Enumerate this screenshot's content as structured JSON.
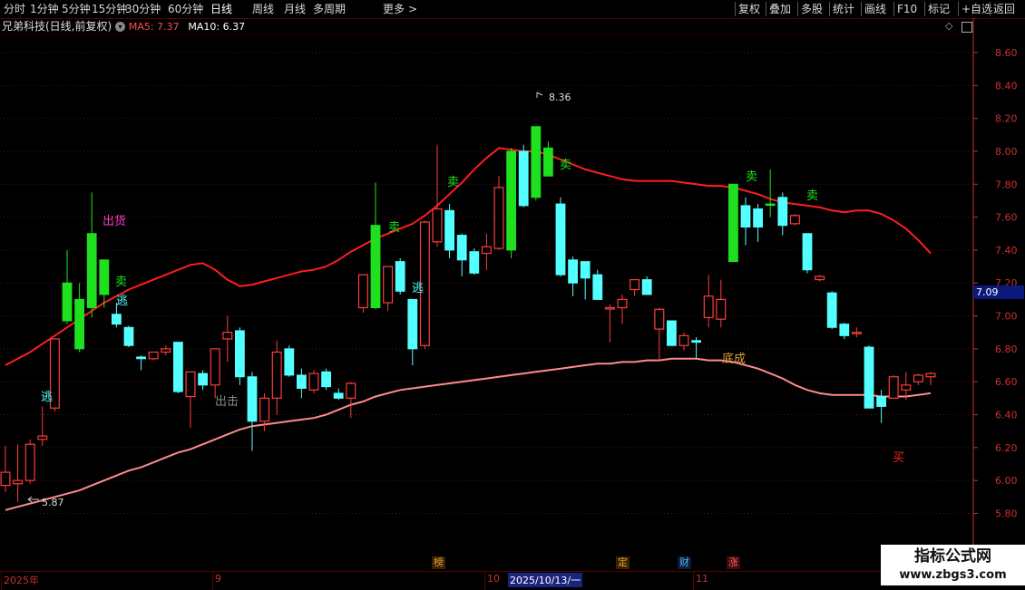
{
  "toolbar": {
    "periods": [
      "分时",
      "1分钟",
      "5分钟",
      "15分钟",
      "30分钟",
      "60分钟",
      "日线",
      "周线",
      "月线",
      "多周期"
    ],
    "active_period": "日线",
    "more_label": "更多",
    "right_buttons": [
      "复权",
      "叠加",
      "多股",
      "统计",
      "画线",
      "F10",
      "标记",
      "+自选",
      "返回"
    ]
  },
  "title": {
    "stock": "兄弟科技(日线,前复权)",
    "ma5": "MA5: 7.37",
    "ma10": "MA10: 6.37"
  },
  "colors": {
    "up": "#ff3c3c",
    "down": "#54ffff",
    "signal_green": "#1ee01e",
    "ma_red": "#ff1e1e",
    "ma_pink": "#ff8a8a",
    "ma5_text": "#ff4b4b",
    "ma10_text": "#ffffff",
    "axis": "#c83030"
  },
  "axis": {
    "ticks": [
      "8.60",
      "8.40",
      "8.20",
      "8.00",
      "7.80",
      "7.60",
      "7.40",
      "7.20",
      "7.00",
      "6.80",
      "6.60",
      "6.40",
      "6.20",
      "6.00",
      "5.80"
    ],
    "last_price": "7.09"
  },
  "dates": {
    "labels": [
      "2025年",
      "9",
      "10",
      "2025/10/13/一",
      "11"
    ]
  },
  "events": [
    "榜",
    "定",
    "财",
    "涨"
  ],
  "annotations": {
    "high": "8.36",
    "low": "5.87",
    "sell": "卖",
    "escape": "逃",
    "ship": "出货",
    "attack": "出击",
    "bottom": "底成",
    "buy": "买"
  },
  "watermark": {
    "line1": "指标公式网",
    "line2": "www.zbgs3.com"
  },
  "chart_data": {
    "type": "candlestick",
    "ylim": [
      5.74,
      8.72
    ],
    "candles": [
      {
        "o": 5.97,
        "h": 6.21,
        "l": 5.93,
        "c": 6.05,
        "sig": ""
      },
      {
        "o": 5.98,
        "h": 6.22,
        "l": 5.87,
        "c": 6.0,
        "sig": ""
      },
      {
        "o": 6.0,
        "h": 6.25,
        "l": 5.98,
        "c": 6.22,
        "sig": ""
      },
      {
        "o": 6.25,
        "h": 6.45,
        "l": 6.21,
        "c": 6.27,
        "sig": ""
      },
      {
        "o": 6.44,
        "h": 6.86,
        "l": 6.42,
        "c": 6.86,
        "sig": ""
      },
      {
        "o": 6.97,
        "h": 7.4,
        "l": 6.95,
        "c": 7.2,
        "sig": "g"
      },
      {
        "o": 6.8,
        "h": 7.2,
        "l": 6.78,
        "c": 7.1,
        "sig": "g"
      },
      {
        "o": 7.05,
        "h": 7.75,
        "l": 6.99,
        "c": 7.5,
        "sig": "g"
      },
      {
        "o": 7.34,
        "h": 7.34,
        "l": 7.05,
        "c": 7.13,
        "sig": "g"
      },
      {
        "o": 7.01,
        "h": 7.08,
        "l": 6.93,
        "c": 6.95,
        "sig": ""
      },
      {
        "o": 6.93,
        "h": 6.94,
        "l": 6.81,
        "c": 6.82,
        "sig": ""
      },
      {
        "o": 6.75,
        "h": 6.76,
        "l": 6.67,
        "c": 6.74,
        "sig": ""
      },
      {
        "o": 6.74,
        "h": 6.78,
        "l": 6.73,
        "c": 6.78,
        "sig": ""
      },
      {
        "o": 6.78,
        "h": 6.82,
        "l": 6.76,
        "c": 6.8,
        "sig": ""
      },
      {
        "o": 6.84,
        "h": 6.84,
        "l": 6.53,
        "c": 6.54,
        "sig": ""
      },
      {
        "o": 6.51,
        "h": 6.66,
        "l": 6.32,
        "c": 6.66,
        "sig": ""
      },
      {
        "o": 6.65,
        "h": 6.67,
        "l": 6.55,
        "c": 6.58,
        "sig": ""
      },
      {
        "o": 6.58,
        "h": 6.78,
        "l": 6.5,
        "c": 6.8,
        "sig": ""
      },
      {
        "o": 6.86,
        "h": 7.0,
        "l": 6.72,
        "c": 6.9,
        "sig": ""
      },
      {
        "o": 6.91,
        "h": 6.93,
        "l": 6.58,
        "c": 6.63,
        "sig": ""
      },
      {
        "o": 6.63,
        "h": 6.66,
        "l": 6.18,
        "c": 6.36,
        "sig": ""
      },
      {
        "o": 6.36,
        "h": 6.53,
        "l": 6.3,
        "c": 6.5,
        "sig": ""
      },
      {
        "o": 6.5,
        "h": 6.85,
        "l": 6.4,
        "c": 6.78,
        "sig": ""
      },
      {
        "o": 6.8,
        "h": 6.82,
        "l": 6.63,
        "c": 6.64,
        "sig": ""
      },
      {
        "o": 6.64,
        "h": 6.68,
        "l": 6.5,
        "c": 6.56,
        "sig": ""
      },
      {
        "o": 6.55,
        "h": 6.67,
        "l": 6.53,
        "c": 6.65,
        "sig": ""
      },
      {
        "o": 6.66,
        "h": 6.68,
        "l": 6.55,
        "c": 6.57,
        "sig": ""
      },
      {
        "o": 6.53,
        "h": 6.56,
        "l": 6.49,
        "c": 6.5,
        "sig": ""
      },
      {
        "o": 6.5,
        "h": 6.6,
        "l": 6.38,
        "c": 6.59,
        "sig": ""
      },
      {
        "o": 7.05,
        "h": 7.25,
        "l": 7.02,
        "c": 7.25,
        "sig": ""
      },
      {
        "o": 7.55,
        "h": 7.81,
        "l": 7.04,
        "c": 7.05,
        "sig": "g"
      },
      {
        "o": 7.08,
        "h": 7.3,
        "l": 7.03,
        "c": 7.3,
        "sig": ""
      },
      {
        "o": 7.33,
        "h": 7.35,
        "l": 7.13,
        "c": 7.15,
        "sig": ""
      },
      {
        "o": 7.1,
        "h": 7.1,
        "l": 6.7,
        "c": 6.8,
        "sig": ""
      },
      {
        "o": 6.82,
        "h": 7.58,
        "l": 6.8,
        "c": 7.57,
        "sig": ""
      },
      {
        "o": 7.45,
        "h": 8.04,
        "l": 7.42,
        "c": 7.65,
        "sig": ""
      },
      {
        "o": 7.64,
        "h": 7.68,
        "l": 7.35,
        "c": 7.4,
        "sig": ""
      },
      {
        "o": 7.49,
        "h": 7.5,
        "l": 7.24,
        "c": 7.34,
        "sig": ""
      },
      {
        "o": 7.39,
        "h": 7.41,
        "l": 7.25,
        "c": 7.26,
        "sig": ""
      },
      {
        "o": 7.38,
        "h": 7.5,
        "l": 7.28,
        "c": 7.42,
        "sig": ""
      },
      {
        "o": 7.41,
        "h": 7.85,
        "l": 7.4,
        "c": 7.78,
        "sig": ""
      },
      {
        "o": 7.4,
        "h": 8.02,
        "l": 7.35,
        "c": 8.0,
        "sig": "g"
      },
      {
        "o": 8.0,
        "h": 8.04,
        "l": 7.66,
        "c": 7.67,
        "sig": ""
      },
      {
        "o": 7.72,
        "h": 8.15,
        "l": 7.7,
        "c": 8.15,
        "sig": "g"
      },
      {
        "o": 8.02,
        "h": 8.06,
        "l": 7.86,
        "c": 7.85,
        "sig": "g"
      },
      {
        "o": 7.68,
        "h": 7.72,
        "l": 7.24,
        "c": 7.25,
        "sig": ""
      },
      {
        "o": 7.34,
        "h": 7.36,
        "l": 7.12,
        "c": 7.2,
        "sig": ""
      },
      {
        "o": 7.33,
        "h": 7.33,
        "l": 7.1,
        "c": 7.23,
        "sig": ""
      },
      {
        "o": 7.25,
        "h": 7.28,
        "l": 7.1,
        "c": 7.1,
        "sig": ""
      },
      {
        "o": 7.05,
        "h": 7.07,
        "l": 6.84,
        "c": 7.05,
        "sig": ""
      },
      {
        "o": 7.05,
        "h": 7.13,
        "l": 6.95,
        "c": 7.1,
        "sig": ""
      },
      {
        "o": 7.16,
        "h": 7.22,
        "l": 7.12,
        "c": 7.22,
        "sig": ""
      },
      {
        "o": 7.22,
        "h": 7.24,
        "l": 7.13,
        "c": 7.13,
        "sig": ""
      },
      {
        "o": 6.92,
        "h": 7.05,
        "l": 6.73,
        "c": 7.04,
        "sig": ""
      },
      {
        "o": 6.97,
        "h": 6.97,
        "l": 6.82,
        "c": 6.82,
        "sig": ""
      },
      {
        "o": 6.82,
        "h": 6.9,
        "l": 6.79,
        "c": 6.88,
        "sig": ""
      },
      {
        "o": 6.85,
        "h": 6.87,
        "l": 6.74,
        "c": 6.84,
        "sig": ""
      },
      {
        "o": 6.99,
        "h": 7.25,
        "l": 6.93,
        "c": 7.12,
        "sig": ""
      },
      {
        "o": 6.98,
        "h": 7.22,
        "l": 6.93,
        "c": 7.1,
        "sig": ""
      },
      {
        "o": 7.33,
        "h": 7.8,
        "l": 7.33,
        "c": 7.8,
        "sig": "g"
      },
      {
        "o": 7.67,
        "h": 7.72,
        "l": 7.43,
        "c": 7.54,
        "sig": ""
      },
      {
        "o": 7.65,
        "h": 7.68,
        "l": 7.45,
        "c": 7.54,
        "sig": ""
      },
      {
        "o": 7.68,
        "h": 7.89,
        "l": 7.6,
        "c": 7.68,
        "sig": "g"
      },
      {
        "o": 7.72,
        "h": 7.75,
        "l": 7.49,
        "c": 7.55,
        "sig": ""
      },
      {
        "o": 7.56,
        "h": 7.62,
        "l": 7.55,
        "c": 7.61,
        "sig": ""
      },
      {
        "o": 7.5,
        "h": 7.5,
        "l": 7.26,
        "c": 7.28,
        "sig": ""
      },
      {
        "o": 7.22,
        "h": 7.25,
        "l": 7.21,
        "c": 7.24,
        "sig": ""
      },
      {
        "o": 7.14,
        "h": 7.15,
        "l": 6.92,
        "c": 6.93,
        "sig": ""
      },
      {
        "o": 6.95,
        "h": 6.96,
        "l": 6.86,
        "c": 6.88,
        "sig": ""
      },
      {
        "o": 6.9,
        "h": 6.93,
        "l": 6.87,
        "c": 6.9,
        "sig": ""
      },
      {
        "o": 6.81,
        "h": 6.82,
        "l": 6.44,
        "c": 6.44,
        "sig": ""
      },
      {
        "o": 6.51,
        "h": 6.55,
        "l": 6.35,
        "c": 6.45,
        "sig": ""
      },
      {
        "o": 6.5,
        "h": 6.64,
        "l": 6.5,
        "c": 6.63,
        "sig": ""
      },
      {
        "o": 6.55,
        "h": 6.66,
        "l": 6.49,
        "c": 6.58,
        "sig": ""
      },
      {
        "o": 6.6,
        "h": 6.65,
        "l": 6.58,
        "c": 6.64,
        "sig": ""
      },
      {
        "o": 6.63,
        "h": 6.66,
        "l": 6.58,
        "c": 6.65,
        "sig": ""
      }
    ],
    "ma_red": [
      6.7,
      6.74,
      6.78,
      6.83,
      6.88,
      6.93,
      6.98,
      7.03,
      7.08,
      7.12,
      7.16,
      7.19,
      7.22,
      7.25,
      7.28,
      7.31,
      7.32,
      7.28,
      7.22,
      7.18,
      7.19,
      7.21,
      7.23,
      7.25,
      7.27,
      7.28,
      7.3,
      7.34,
      7.39,
      7.43,
      7.47,
      7.5,
      7.53,
      7.56,
      7.61,
      7.67,
      7.74,
      7.81,
      7.89,
      7.96,
      8.02,
      8.01,
      8.0,
      8.0,
      7.98,
      7.95,
      7.92,
      7.89,
      7.87,
      7.85,
      7.83,
      7.82,
      7.82,
      7.82,
      7.82,
      7.81,
      7.8,
      7.79,
      7.79,
      7.78,
      7.76,
      7.74,
      7.71,
      7.69,
      7.68,
      7.67,
      7.66,
      7.64,
      7.63,
      7.64,
      7.64,
      7.62,
      7.58,
      7.53,
      7.46,
      7.38
    ],
    "ma_pink": [
      5.82,
      5.84,
      5.86,
      5.88,
      5.9,
      5.92,
      5.94,
      5.97,
      6.0,
      6.03,
      6.06,
      6.08,
      6.11,
      6.14,
      6.17,
      6.19,
      6.22,
      6.25,
      6.28,
      6.31,
      6.33,
      6.34,
      6.35,
      6.36,
      6.37,
      6.38,
      6.4,
      6.43,
      6.46,
      6.48,
      6.51,
      6.53,
      6.55,
      6.56,
      6.57,
      6.58,
      6.59,
      6.6,
      6.61,
      6.62,
      6.63,
      6.64,
      6.65,
      6.66,
      6.67,
      6.68,
      6.69,
      6.7,
      6.71,
      6.71,
      6.72,
      6.72,
      6.73,
      6.73,
      6.74,
      6.74,
      6.74,
      6.73,
      6.73,
      6.72,
      6.7,
      6.68,
      6.65,
      6.62,
      6.58,
      6.55,
      6.53,
      6.52,
      6.52,
      6.52,
      6.52,
      6.51,
      6.51,
      6.51,
      6.52,
      6.53
    ]
  }
}
